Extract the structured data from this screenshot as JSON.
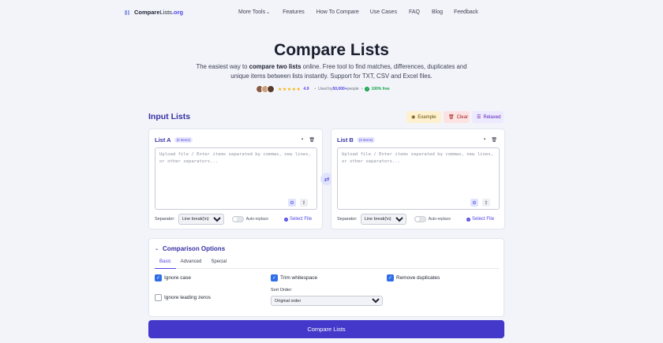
{
  "brand": {
    "name_part1": "Compare",
    "name_part2": "Lists",
    "name_part3": ".org"
  },
  "nav": {
    "more_tools": "More Tools",
    "features": "Features",
    "how_to": "How To Compare",
    "use_cases": "Use Cases",
    "faq": "FAQ",
    "blog": "Blog",
    "feedback": "Feedback"
  },
  "hero": {
    "title": "Compare Lists",
    "sub_1": "The easiest way to ",
    "sub_bold": "compare two lists",
    "sub_2": " online. Free tool to find matches, differences, duplicates and unique items between lists instantly. Support for TXT, CSV and Excel files."
  },
  "social": {
    "stars": "★★★★★",
    "rating": "4.9",
    "used_by": "Used by ",
    "users": "50,000+",
    "people": " people",
    "free": "100% free"
  },
  "input_lists": {
    "title": "Input Lists",
    "example": "Example",
    "clear": "Clear",
    "relaxed": "Relaxed"
  },
  "list_a": {
    "title": "List A",
    "count": "(0 items)",
    "placeholder": "Upload file / Enter items separated by commas, new lines, or other separators...",
    "separator_label": "Separator:",
    "separator_value": "Line break(\\n)",
    "auto_replace": "Auto-replace",
    "select_file": "Select File"
  },
  "list_b": {
    "title": "List B",
    "count": "(0 items)",
    "placeholder": "Upload file / Enter items separated by commas, new lines, or other separators...",
    "separator_label": "Separator:",
    "separator_value": "Line break(\\n)",
    "auto_replace": "Auto-replace",
    "select_file": "Select File"
  },
  "options": {
    "title": "Comparison Options",
    "tabs": [
      "Basic",
      "Advanced",
      "Special"
    ],
    "ignore_case": "Ignore case",
    "trim_whitespace": "Trim whitespace",
    "remove_duplicates": "Remove duplicates",
    "ignore_leading_zeros": "Ignore leading zeros",
    "sort_order_label": "Sort Order:",
    "sort_order_value": "Original order"
  },
  "compare_button": "Compare Lists",
  "colors": {
    "accent": "#4f46e5",
    "button": "#4338ca",
    "checkbox": "#2f6ee8"
  }
}
